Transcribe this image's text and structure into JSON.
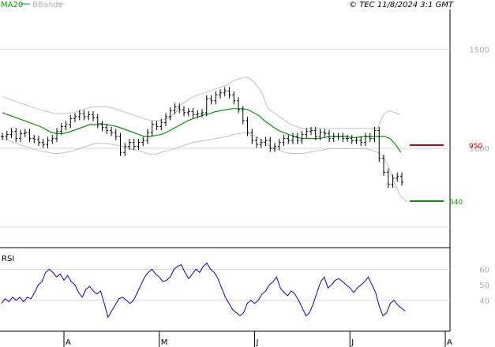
{
  "header": {
    "ma_label": "MA20",
    "bb_label": "BBands",
    "copyright": "© TEC 11/8/2024 3:1 GMT"
  },
  "colors": {
    "ma": "#009900",
    "bbands": "#c0c0c0",
    "price": "#000000",
    "rsi": "#0000cc",
    "resistance": "#cc0000",
    "support": "#009900",
    "grid": "#d8d8d8",
    "frame": "#000000"
  },
  "chart_data": [
    {
      "type": "ohlc",
      "price_axis": {
        "ylim": [
          500,
          1700
        ],
        "ticks": [
          {
            "value": 1500,
            "label": "1500"
          },
          {
            "value": 1000,
            "label": "1000"
          }
        ]
      },
      "time_axis": {
        "ticks": [
          {
            "label": "A",
            "index": 16
          },
          {
            "label": "M",
            "index": 37
          },
          {
            "label": "J",
            "index": 58
          },
          {
            "label": "J",
            "index": 79
          },
          {
            "label": "A",
            "index": 100
          }
        ]
      },
      "series_close": [
        1060,
        1070,
        1085,
        1050,
        1075,
        1080,
        1050,
        1045,
        1030,
        1020,
        1040,
        1050,
        1085,
        1110,
        1120,
        1150,
        1160,
        1175,
        1160,
        1170,
        1155,
        1120,
        1105,
        1090,
        1080,
        1060,
        980,
        1010,
        1030,
        1010,
        1030,
        1040,
        1080,
        1120,
        1110,
        1130,
        1160,
        1190,
        1210,
        1195,
        1180,
        1185,
        1170,
        1175,
        1180,
        1250,
        1240,
        1270,
        1280,
        1290,
        1270,
        1240,
        1195,
        1140,
        1080,
        1040,
        1020,
        1030,
        1040,
        1000,
        1010,
        1030,
        1050,
        1040,
        1060,
        1040,
        1070,
        1085,
        1090,
        1060,
        1080,
        1075,
        1050,
        1060,
        1060,
        1050,
        1050,
        1040,
        1040,
        1030,
        1060,
        1050,
        1090,
        950,
        880,
        820,
        850,
        860,
        830
      ],
      "ma20": [
        1180,
        1170,
        1160,
        1150,
        1140,
        1130,
        1120,
        1110,
        1095,
        1080,
        1075,
        1075,
        1080,
        1090,
        1100,
        1110,
        1120,
        1120,
        1125,
        1120,
        1115,
        1110,
        1100,
        1090,
        1080,
        1070,
        1060,
        1060,
        1065,
        1070,
        1080,
        1095,
        1110,
        1125,
        1140,
        1150,
        1160,
        1170,
        1175,
        1185,
        1190,
        1195,
        1200,
        1200,
        1200,
        1195,
        1180,
        1165,
        1140,
        1120,
        1100,
        1085,
        1075,
        1065,
        1055,
        1050,
        1050,
        1050,
        1050,
        1055,
        1060,
        1060,
        1060,
        1060,
        1055,
        1055,
        1060,
        1060,
        1060,
        1060,
        1060,
        1050,
        1020,
        980
      ],
      "bb_upper": [
        1260,
        1250,
        1240,
        1230,
        1220,
        1210,
        1200,
        1190,
        1185,
        1175,
        1175,
        1175,
        1180,
        1185,
        1195,
        1205,
        1210,
        1210,
        1210,
        1205,
        1195,
        1185,
        1175,
        1165,
        1155,
        1145,
        1140,
        1140,
        1145,
        1155,
        1180,
        1220,
        1240,
        1260,
        1270,
        1280,
        1290,
        1300,
        1310,
        1320,
        1340,
        1350,
        1360,
        1350,
        1320,
        1280,
        1200,
        1180,
        1160,
        1140,
        1120,
        1110,
        1100,
        1100,
        1100,
        1100,
        1100,
        1100,
        1100,
        1100,
        1100,
        1100,
        1100,
        1100,
        1100,
        1100,
        1170,
        1190,
        1180,
        1170
      ],
      "bb_lower": [
        1050,
        1040,
        1030,
        1020,
        1010,
        1000,
        990,
        985,
        980,
        975,
        975,
        980,
        985,
        995,
        1005,
        1015,
        1025,
        1025,
        1025,
        1020,
        1015,
        1010,
        1000,
        990,
        985,
        975,
        970,
        975,
        985,
        990,
        1000,
        1010,
        1020,
        1030,
        1035,
        1040,
        1045,
        1050,
        1055,
        1060,
        1070,
        1075,
        1080,
        1070,
        1060,
        1040,
        1020,
        1000,
        990,
        980,
        975,
        975,
        975,
        980,
        985,
        990,
        995,
        1000,
        1000,
        1000,
        1000,
        1000,
        1000,
        1000,
        990,
        980,
        960,
        900,
        820,
        760,
        730
      ],
      "resistance": {
        "value": 950,
        "label": "950"
      },
      "support": {
        "value": 640,
        "label": "640"
      }
    },
    {
      "type": "line",
      "title": "RSI",
      "ylim": [
        20,
        72
      ],
      "ticks": [
        {
          "value": 60,
          "label": "60"
        },
        {
          "value": 50,
          "label": "50"
        },
        {
          "value": 40,
          "label": "40"
        }
      ],
      "series": [
        {
          "values": [
            38,
            41,
            39,
            42,
            40,
            42,
            39,
            42,
            41,
            45,
            50,
            52,
            58,
            60,
            58,
            55,
            57,
            53,
            56,
            52,
            50,
            45,
            42,
            47,
            49,
            46,
            44,
            46,
            38,
            29,
            33,
            37,
            41,
            42,
            40,
            38,
            40,
            45,
            50,
            55,
            58,
            60,
            57,
            55,
            52,
            53,
            55,
            60,
            62,
            63,
            58,
            54,
            57,
            60,
            58,
            62,
            64,
            60,
            58,
            54,
            48,
            42,
            38,
            34,
            32,
            30,
            32,
            38,
            40,
            38,
            40,
            44,
            46,
            50,
            52,
            55,
            48,
            45,
            43,
            46,
            44,
            40,
            35,
            30,
            32,
            38,
            45,
            52,
            55,
            48,
            50,
            53,
            54,
            52,
            50,
            48,
            45,
            48,
            50,
            52,
            55,
            50,
            45,
            36,
            30,
            32,
            38,
            40,
            37,
            35,
            33
          ]
        }
      ]
    }
  ]
}
